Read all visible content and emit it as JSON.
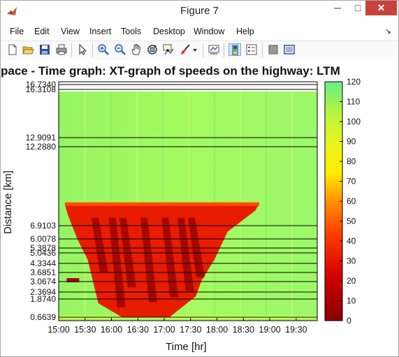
{
  "window": {
    "title": "Figure 7",
    "minimize_glyph": "─",
    "maximize_glyph": "□",
    "close_glyph": "✕"
  },
  "menu": [
    "File",
    "Edit",
    "View",
    "Insert",
    "Tools",
    "Desktop",
    "Window",
    "Help"
  ],
  "menu_dock_glyph": "↘",
  "toolbar_icons": [
    "new-figure-icon",
    "open-file-icon",
    "save-icon",
    "print-icon",
    "edit-plot-arrow-icon",
    "zoom-in-icon",
    "zoom-out-icon",
    "pan-hand-icon",
    "rotate-3d-icon",
    "data-cursor-icon",
    "brush-icon",
    "brush-dropdown-icon",
    "link-plot-icon",
    "colorbar-icon",
    "legend-icon",
    "hide-plot-tools-icon",
    "show-plot-tools-icon"
  ],
  "chart_data": {
    "type": "heatmap",
    "title": "pace - Time graph: XT-graph of speeds on the highway: LTM",
    "xlabel": "Time [hr]",
    "ylabel": "Distance [km]",
    "x_tick_labels": [
      "15:00",
      "15:30",
      "16:00",
      "16:30",
      "17:00",
      "17:30",
      "18:00",
      "18:30",
      "19:00",
      "19:30"
    ],
    "x_range_hours": [
      15.0,
      19.9
    ],
    "y_tick_labels": [
      "16.7340",
      "16.3108",
      "12.9091",
      "12.2880",
      "6.9103",
      "6.0078",
      "5.3878",
      "5.0436",
      "4.3344",
      "3.6851",
      "3.0674",
      "2.3694",
      "1.8740",
      "0.6639"
    ],
    "y_ticks_km": [
      16.734,
      16.3108,
      12.9091,
      12.288,
      6.9103,
      6.0078,
      5.3878,
      5.0436,
      4.3344,
      3.6851,
      3.0674,
      2.3694,
      1.874,
      0.6639
    ],
    "colorbar": {
      "min": 0,
      "max": 120,
      "tick_labels": [
        "0",
        "10",
        "20",
        "30",
        "40",
        "50",
        "60",
        "70",
        "80",
        "90",
        "100",
        "110",
        "120"
      ],
      "colormap": "hot (dark red → red → yellow → green)"
    },
    "free_flow_speed": 110,
    "congestion": {
      "time_start": "15:07",
      "time_end": "18:48",
      "distance_top_km": 8.4,
      "distance_bottom_km": 0.66,
      "min_speed": 5,
      "typical_speed": 25
    }
  },
  "colors": {
    "close_button": "#c7423b",
    "free_flow": "#9cfa64",
    "congested": "#e81c00",
    "jam": "#900000"
  }
}
